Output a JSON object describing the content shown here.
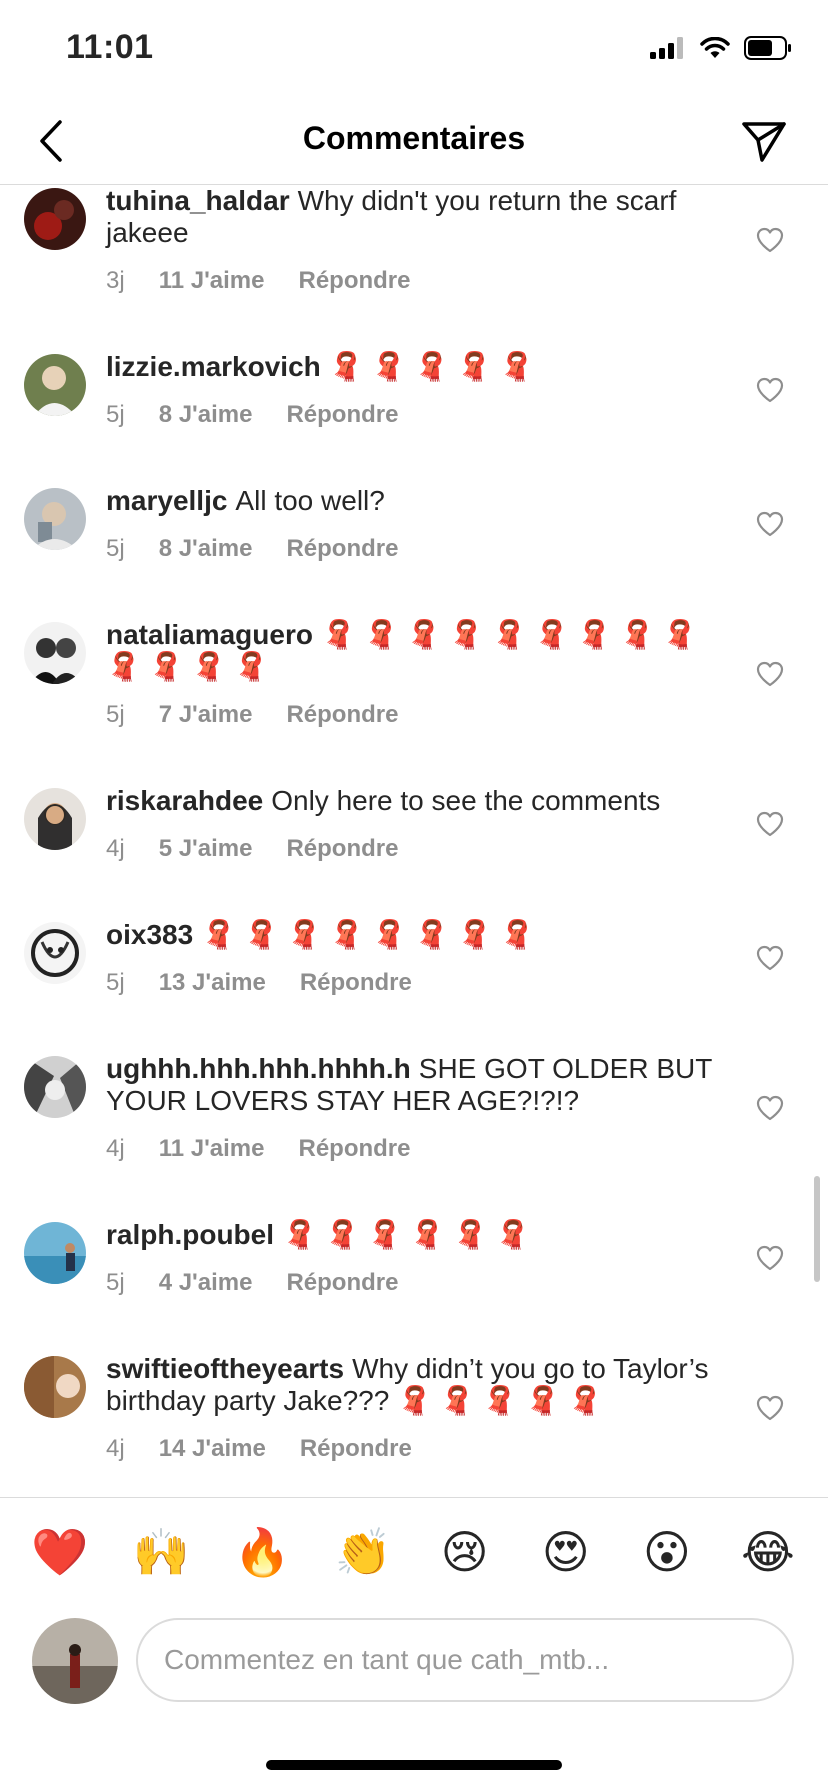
{
  "status": {
    "time": "11:01"
  },
  "nav": {
    "title": "Commentaires",
    "back_icon": "chevron-left-icon",
    "send_icon": "paper-plane-icon"
  },
  "comments": [
    {
      "username": "tuhina_haldar",
      "text": "Why didn't you return the scarf jakeee",
      "age": "3j",
      "likes": "11 J'aime",
      "reply": "Répondre"
    },
    {
      "username": "lizzie.markovich",
      "text": "🧣 🧣 🧣 🧣 🧣",
      "age": "5j",
      "likes": "8 J'aime",
      "reply": "Répondre"
    },
    {
      "username": "maryelljc",
      "text": "All too well?",
      "age": "5j",
      "likes": "8 J'aime",
      "reply": "Répondre"
    },
    {
      "username": "nataliamaguero",
      "text": "🧣 🧣 🧣 🧣 🧣 🧣 🧣 🧣 🧣 🧣 🧣 🧣 🧣",
      "age": "5j",
      "likes": "7 J'aime",
      "reply": "Répondre"
    },
    {
      "username": "riskarahdee",
      "text": "Only here to see the comments",
      "age": "4j",
      "likes": "5 J'aime",
      "reply": "Répondre"
    },
    {
      "username": "oix383",
      "text": "🧣 🧣 🧣 🧣 🧣 🧣 🧣 🧣",
      "age": "5j",
      "likes": "13 J'aime",
      "reply": "Répondre"
    },
    {
      "username": "ughhh.hhh.hhh.hhhh.h",
      "text": "SHE GOT OLDER BUT YOUR LOVERS STAY HER AGE?!?!?",
      "age": "4j",
      "likes": "11 J'aime",
      "reply": "Répondre"
    },
    {
      "username": "ralph.poubel",
      "text": "🧣 🧣 🧣 🧣 🧣 🧣",
      "age": "5j",
      "likes": "4 J'aime",
      "reply": "Répondre"
    },
    {
      "username": "swiftieoftheyearts",
      "text": "Why didn’t you go to Taylor’s birthday party Jake??? 🧣 🧣 🧣 🧣 🧣",
      "age": "4j",
      "likes": "14 J'aime",
      "reply": "Répondre"
    }
  ],
  "emoji_bar": [
    "❤️",
    "🙌",
    "🔥",
    "👏",
    "😢",
    "😍",
    "😮",
    "😂"
  ],
  "composer": {
    "placeholder": "Commentez en tant que cath_mtb..."
  },
  "colors": {
    "text": "#262626",
    "meta": "#8e8e8e",
    "divider": "#dbdbdb"
  }
}
